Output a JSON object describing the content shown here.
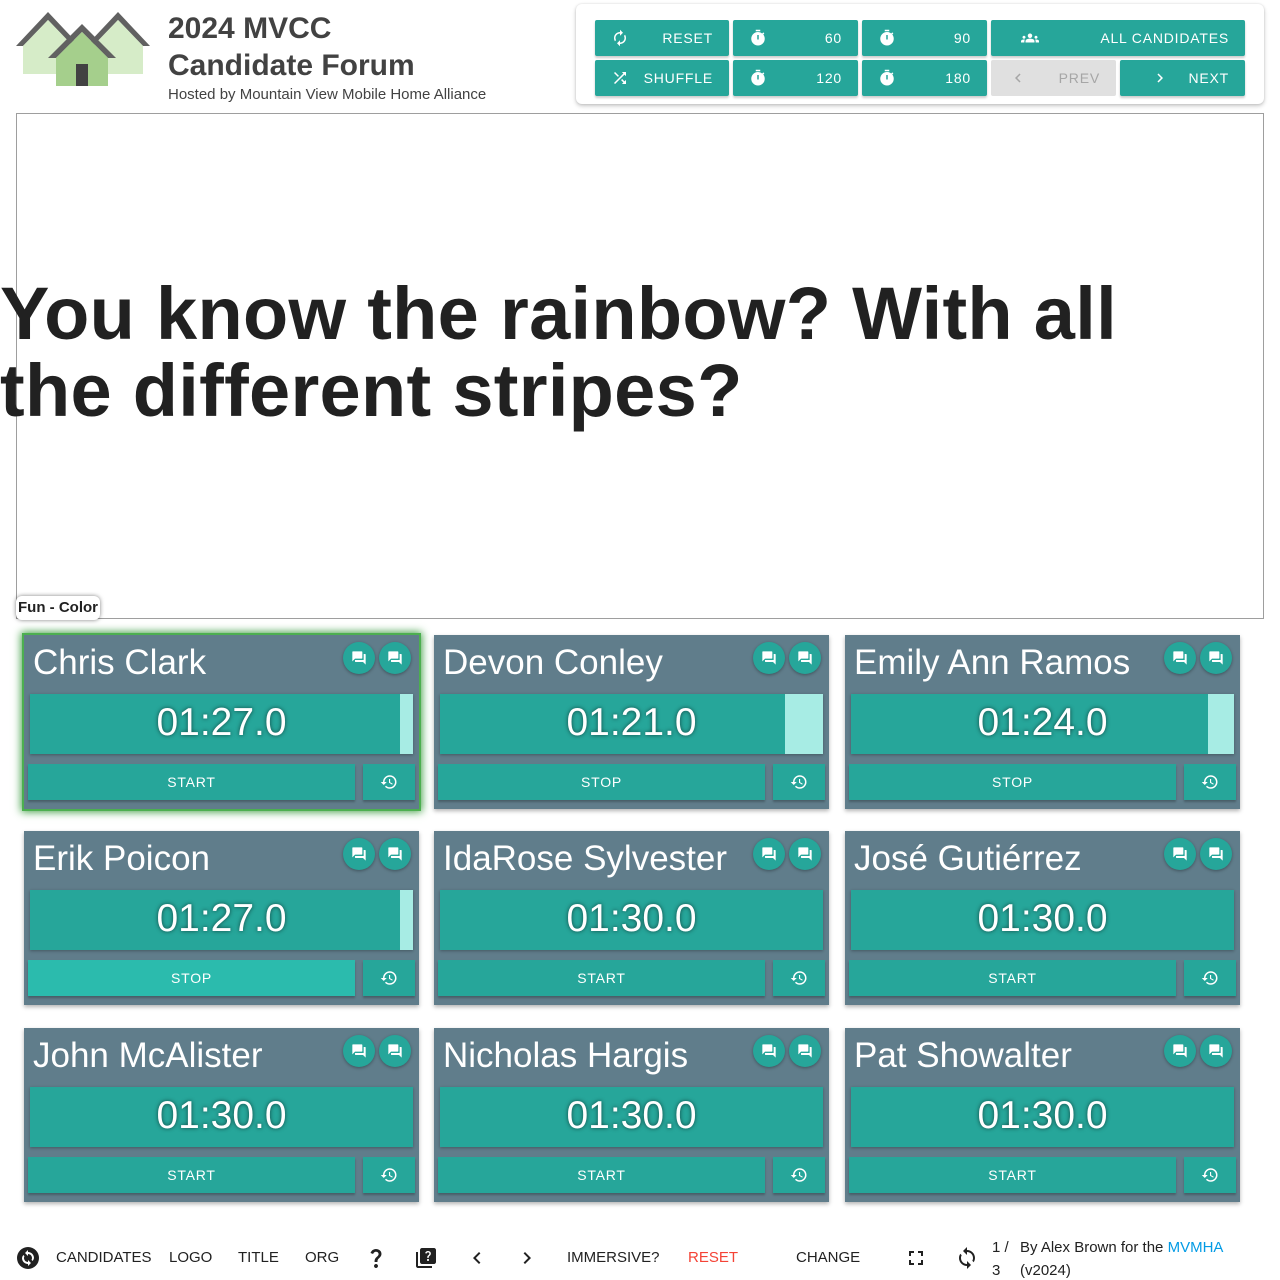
{
  "header": {
    "title_line1": "2024 MVCC",
    "title_line2": "Candidate Forum",
    "subtitle": "Hosted by Mountain View Mobile Home Alliance"
  },
  "controls": {
    "reset": "RESET",
    "shuffle": "SHUFFLE",
    "t60": "60",
    "t90": "90",
    "t120": "120",
    "t180": "180",
    "all_candidates": "ALL CANDIDATES",
    "prev": "PREV",
    "next": "NEXT"
  },
  "question": {
    "text": "You know the rainbow? With all the different stripes?",
    "category": "Fun - Color"
  },
  "candidates": [
    {
      "name": "Chris Clark",
      "time": "01:27.0",
      "button": "START",
      "elapsed_fraction": 0.033,
      "active": true,
      "highlight": false
    },
    {
      "name": "Devon Conley",
      "time": "01:21.0",
      "button": "STOP",
      "elapsed_fraction": 0.1,
      "active": false,
      "highlight": false
    },
    {
      "name": "Emily Ann Ramos",
      "time": "01:24.0",
      "button": "STOP",
      "elapsed_fraction": 0.067,
      "active": false,
      "highlight": false
    },
    {
      "name": "Erik Poicon",
      "time": "01:27.0",
      "button": "STOP",
      "elapsed_fraction": 0.033,
      "active": false,
      "highlight": true
    },
    {
      "name": "IdaRose Sylvester",
      "time": "01:30.0",
      "button": "START",
      "elapsed_fraction": 0,
      "active": false,
      "highlight": false
    },
    {
      "name": "José Gutiérrez",
      "time": "01:30.0",
      "button": "START",
      "elapsed_fraction": 0,
      "active": false,
      "highlight": false
    },
    {
      "name": "John McAlister",
      "time": "01:30.0",
      "button": "START",
      "elapsed_fraction": 0,
      "active": false,
      "highlight": false
    },
    {
      "name": "Nicholas Hargis",
      "time": "01:30.0",
      "button": "START",
      "elapsed_fraction": 0,
      "active": false,
      "highlight": false
    },
    {
      "name": "Pat Showalter",
      "time": "01:30.0",
      "button": "START",
      "elapsed_fraction": 0,
      "active": false,
      "highlight": false
    }
  ],
  "footer": {
    "candidates": "CANDIDATES",
    "logo": "LOGO",
    "title": "TITLE",
    "org": "ORG",
    "immersive": "IMMERSIVE?",
    "reset": "RESET",
    "change": "CHANGE",
    "page_top": "1 /",
    "page_bottom": "3",
    "credit_prefix": "By Alex Brown for the ",
    "credit_link": "MVMHA",
    "credit_version": "(v2024)"
  },
  "colors": {
    "accent": "#26a69a",
    "card": "#607d8b",
    "timer_fill": "#a7ece4",
    "active_glow": "#4caf50",
    "reset_red": "#f44336",
    "link": "#039be5"
  },
  "icons": {
    "controls_reset": "refresh-icon",
    "controls_shuffle": "shuffle-icon",
    "controls_timer": "stopwatch-icon",
    "controls_all": "group-icon",
    "controls_prev": "chevron-left-icon",
    "controls_next": "chevron-right-icon",
    "card_question": "chat-bubble-icon",
    "card_history": "history-icon"
  }
}
